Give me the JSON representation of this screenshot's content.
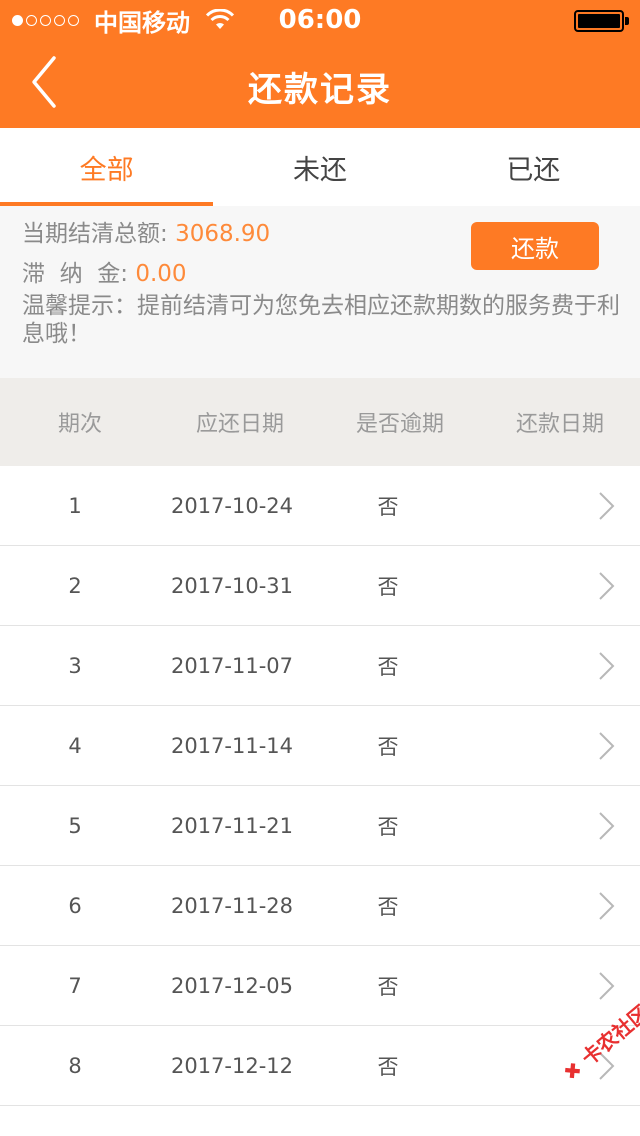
{
  "status_bar": {
    "carrier": "中国移动",
    "time": "06:00",
    "signal_filled": 1,
    "signal_total": 5
  },
  "nav": {
    "title": "还款记录",
    "back_icon": "chevron-left-icon"
  },
  "tabs": [
    {
      "label": "全部",
      "active": true
    },
    {
      "label": "未还",
      "active": false
    },
    {
      "label": "已还",
      "active": false
    }
  ],
  "summary": {
    "total_label": "当期结清总额:",
    "total_value": "3068.90",
    "late_fee_label": "滞  纳  金:",
    "late_fee_value": "0.00",
    "pay_button": "还款",
    "tip": "温馨提示：提前结清可为您免去相应还款期数的服务费于利息哦！"
  },
  "table": {
    "headers": [
      "期次",
      "应还日期",
      "是否逾期",
      "还款日期"
    ],
    "rows": [
      {
        "period": "1",
        "due_date": "2017-10-24",
        "overdue": "否",
        "paid_date": ""
      },
      {
        "period": "2",
        "due_date": "2017-10-31",
        "overdue": "否",
        "paid_date": ""
      },
      {
        "period": "3",
        "due_date": "2017-11-07",
        "overdue": "否",
        "paid_date": ""
      },
      {
        "period": "4",
        "due_date": "2017-11-14",
        "overdue": "否",
        "paid_date": ""
      },
      {
        "period": "5",
        "due_date": "2017-11-21",
        "overdue": "否",
        "paid_date": ""
      },
      {
        "period": "6",
        "due_date": "2017-11-28",
        "overdue": "否",
        "paid_date": ""
      },
      {
        "period": "7",
        "due_date": "2017-12-05",
        "overdue": "否",
        "paid_date": ""
      },
      {
        "period": "8",
        "due_date": "2017-12-12",
        "overdue": "否",
        "paid_date": ""
      }
    ]
  },
  "watermark": "卡农社区",
  "colors": {
    "accent": "#fe7a24",
    "value": "#fe8a3a",
    "header_bg": "#efedea",
    "summary_bg": "#f7f7f7"
  }
}
